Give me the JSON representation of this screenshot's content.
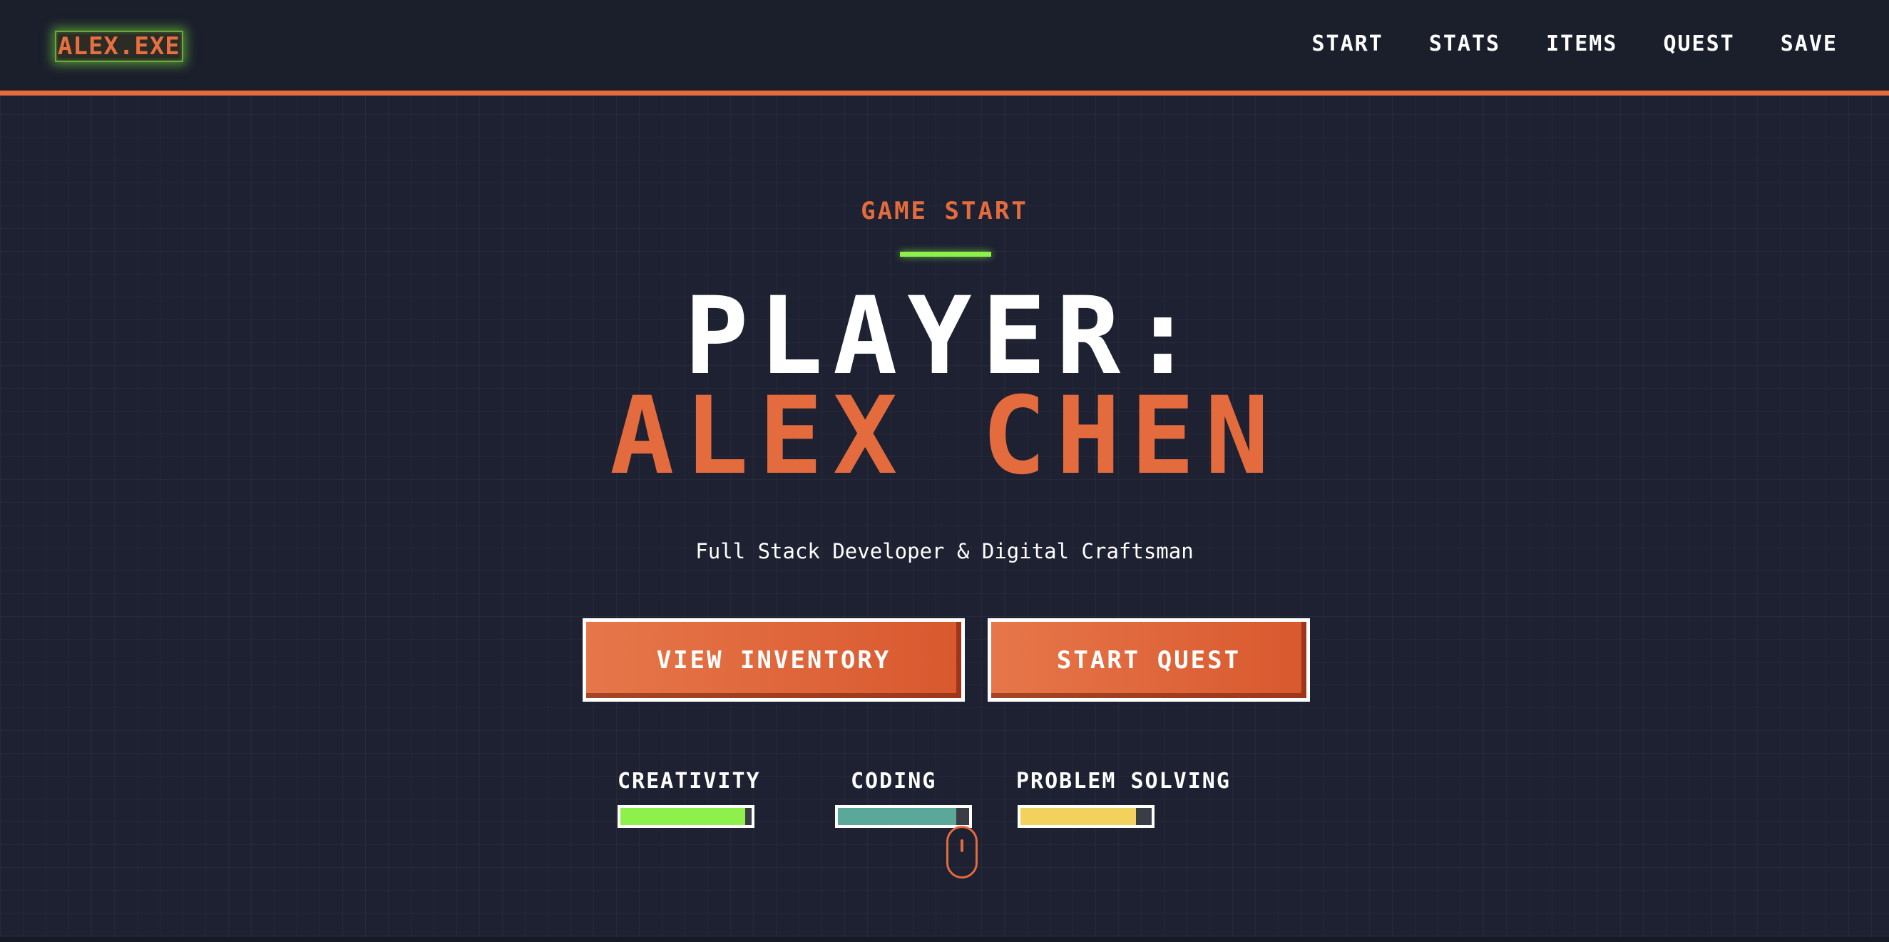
{
  "header": {
    "logo": "ALEX.EXE",
    "nav": [
      "START",
      "STATS",
      "ITEMS",
      "QUEST",
      "SAVE"
    ]
  },
  "hero": {
    "kicker": "GAME START",
    "title_line1": "PLAYER:",
    "title_line2": "ALEX CHEN",
    "tagline": "Full Stack Developer & Digital Craftsman",
    "primary_button": "VIEW INVENTORY",
    "secondary_button": "START QUEST"
  },
  "stats": [
    {
      "label": "CREATIVITY",
      "level": 0.95,
      "color": "#8ef04a"
    },
    {
      "label": "CODING",
      "level": 0.9,
      "color": "#5aa89a"
    },
    {
      "label": "PROBLEM SOLVING",
      "level": 0.88,
      "color": "#f2d25c"
    }
  ],
  "colors": {
    "accent": "#e36b3e",
    "neon_green": "#8ef04a",
    "background": "#1d2131",
    "header": "#1b1f2c"
  },
  "icons": {
    "scroll_indicator": "mouse-scroll-icon"
  }
}
